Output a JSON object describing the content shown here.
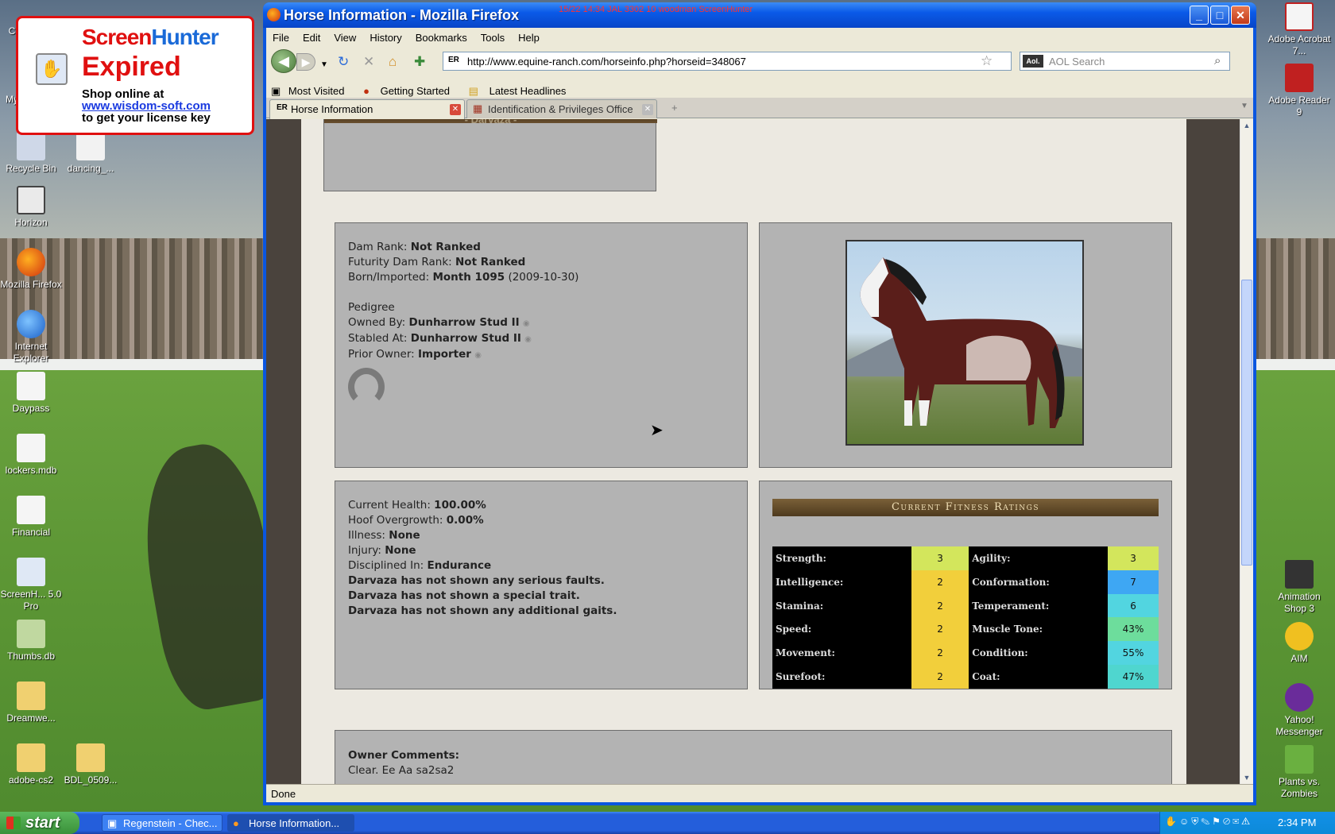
{
  "desktop": {
    "left_icons": [
      {
        "label": "Recycle Bin"
      },
      {
        "label": "dancing_..."
      },
      {
        "label": "Horizon"
      },
      {
        "label": "Mozilla Firefox"
      },
      {
        "label": "Internet Explorer"
      },
      {
        "label": "Daypass"
      },
      {
        "label": "lockers.mdb"
      },
      {
        "label": "Financial"
      },
      {
        "label": "ScreenH... 5.0 Pro"
      },
      {
        "label": "Thumbs.db"
      },
      {
        "label": "Dreamwe..."
      },
      {
        "label": "adobe-cs2"
      },
      {
        "label": "BDL_0509..."
      }
    ],
    "right_icons": [
      {
        "label": "Adobe Acrobat 7..."
      },
      {
        "label": "Adobe Reader 9"
      },
      {
        "label": "Animation Shop 3"
      },
      {
        "label": "AIM"
      },
      {
        "label": "Yahoo! Messenger"
      },
      {
        "label": "Plants vs. Zombies"
      }
    ],
    "partial_labels": {
      "c": "C",
      "my": "My"
    }
  },
  "screenhunter": {
    "logo_a": "Screen",
    "logo_b": "Hunter",
    "expired": "Expired",
    "line1": "Shop online at",
    "link": "www.wisdom-soft.com",
    "line2": "to get your license key"
  },
  "window": {
    "title": "Horse Information - Mozilla Firefox",
    "recording": "15/22  14:34  JAL 3302 10  woodman ScreenHunter"
  },
  "menu": [
    "File",
    "Edit",
    "View",
    "History",
    "Bookmarks",
    "Tools",
    "Help"
  ],
  "nav": {
    "url": "http://www.equine-ranch.com/horseinfo.php?horseid=348067",
    "search_placeholder": "AOL Search",
    "search_engine": "Aol."
  },
  "bookmarks": [
    "Most Visited",
    "Getting Started",
    "Latest Headlines"
  ],
  "tabs": [
    {
      "label": "Horse Information",
      "active": true
    },
    {
      "label": "Identification & Privileges Office",
      "active": false
    }
  ],
  "horse": {
    "name_banner": "- Darvaza -",
    "dam_rank_label": "Dam Rank:",
    "dam_rank": "Not Ranked",
    "futurity_label": "Futurity Dam Rank:",
    "futurity": "Not Ranked",
    "born_label": "Born/Imported:",
    "born": "Month 1095",
    "born_date": "(2009-10-30)",
    "pedigree": "Pedigree",
    "owned_label": "Owned By:",
    "owned": "Dunharrow Stud II",
    "stabled_label": "Stabled At:",
    "stabled": "Dunharrow Stud II",
    "prior_label": "Prior Owner:",
    "prior": "Importer",
    "health_label": "Current Health:",
    "health": "100.00%",
    "hoof_label": "Hoof Overgrowth:",
    "hoof": "0.00%",
    "illness_label": "Illness:",
    "illness": "None",
    "injury_label": "Injury:",
    "injury": "None",
    "disc_label": "Disciplined In:",
    "disc": "Endurance",
    "note1": "Darvaza has not shown any serious faults.",
    "note2": "Darvaza has not shown a special trait.",
    "note3": "Darvaza has not shown any additional gaits.",
    "comments_label": "Owner Comments:",
    "comments": "Clear. Ee Aa sa2sa2"
  },
  "fitness": {
    "header": "Current Fitness Ratings",
    "rows": [
      {
        "l": "Strength:",
        "lv": "3",
        "r": "Agility:",
        "rv": "3"
      },
      {
        "l": "Intelligence:",
        "lv": "2",
        "r": "Conformation:",
        "rv": "7"
      },
      {
        "l": "Stamina:",
        "lv": "2",
        "r": "Temperament:",
        "rv": "6"
      },
      {
        "l": "Speed:",
        "lv": "2",
        "r": "Muscle Tone:",
        "rv": "43%"
      },
      {
        "l": "Movement:",
        "lv": "2",
        "r": "Condition:",
        "rv": "55%"
      },
      {
        "l": "Surefoot:",
        "lv": "2",
        "r": "Coat:",
        "rv": "47%"
      }
    ],
    "colors": {
      "yellow_green": "#d3e65c",
      "yellow": "#f2cf3b",
      "blue": "#3ea7f3",
      "cyan": "#52d5e0",
      "mint": "#6ddd9c",
      "teal": "#4fd6cf"
    }
  },
  "status": "Done",
  "taskbar": {
    "start": "start",
    "items": [
      "Regenstein - Chec...",
      "Horse Information..."
    ],
    "clock": "2:34 PM"
  }
}
